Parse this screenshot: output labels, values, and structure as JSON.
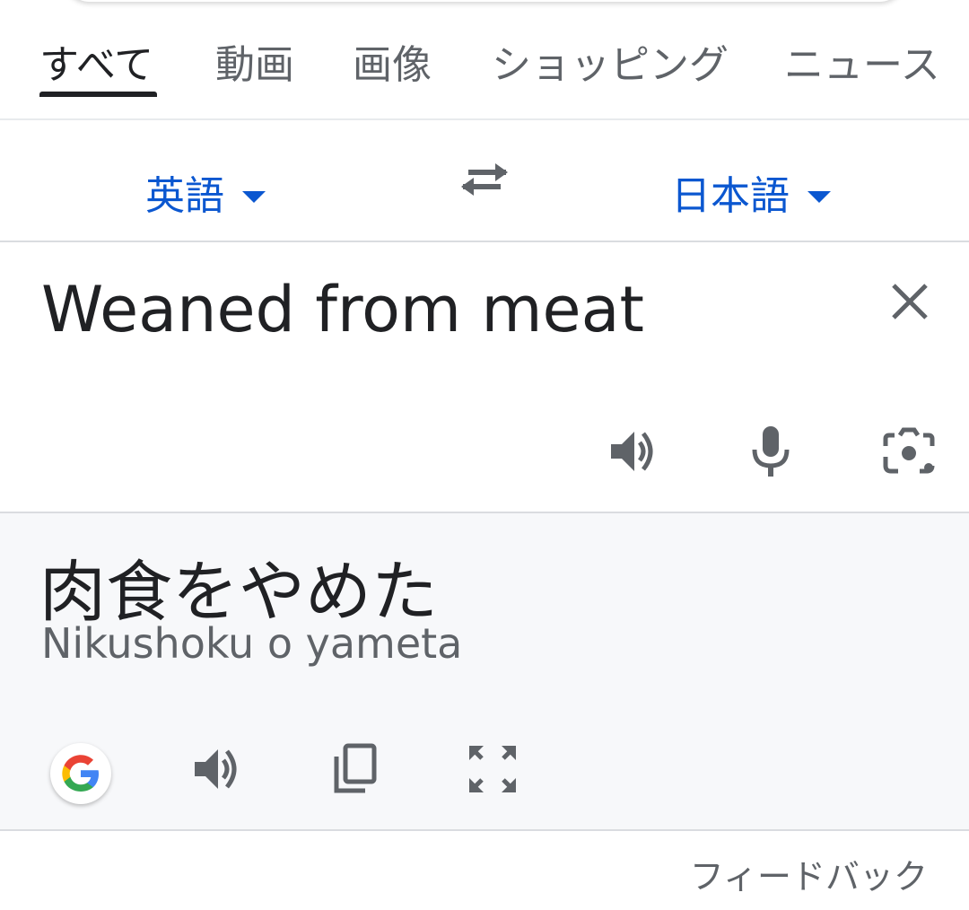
{
  "tabs": [
    {
      "label": "すべて",
      "active": true
    },
    {
      "label": "動画"
    },
    {
      "label": "画像"
    },
    {
      "label": "ショッピング"
    },
    {
      "label": "ニュース"
    }
  ],
  "languages": {
    "source": "英語",
    "target": "日本語"
  },
  "source": {
    "text": "Weaned from meat"
  },
  "result": {
    "text": "肉食をやめた",
    "romanization": "Nikushoku o yameta"
  },
  "footer": {
    "feedback": "フィードバック"
  },
  "colors": {
    "accent": "#0b57d0",
    "icon": "#5f6368",
    "result_bg": "#f7f8fa"
  },
  "icons": [
    "swap-icon",
    "close-icon",
    "speaker-icon",
    "mic-icon",
    "camera-icon",
    "google-logo-icon",
    "copy-icon",
    "fullscreen-icon"
  ]
}
